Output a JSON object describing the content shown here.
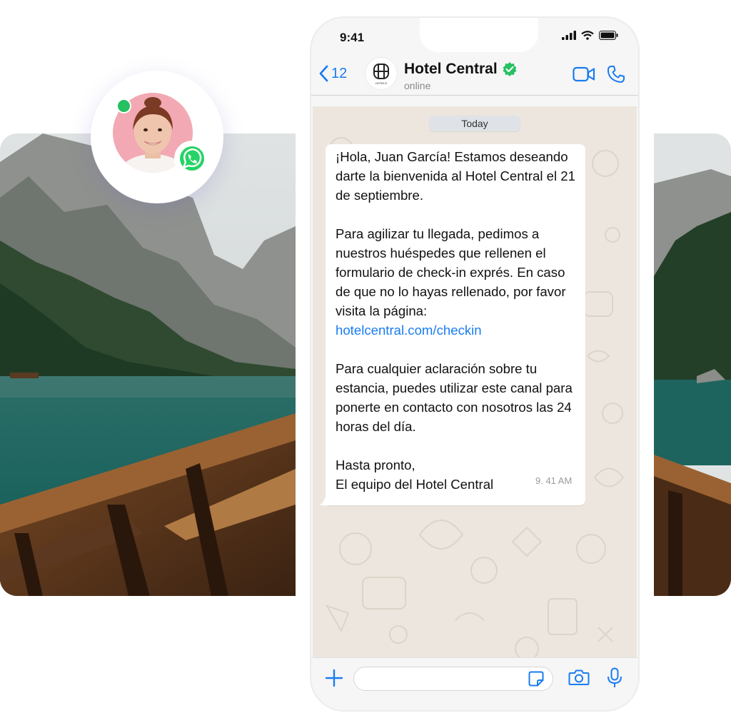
{
  "status_bar": {
    "time": "9:41"
  },
  "header": {
    "back_count": "12",
    "contact_name": "Hotel Central",
    "contact_status": "online",
    "logo_caption": "HOTELS"
  },
  "chat": {
    "date_label": "Today",
    "message": {
      "paragraph_1": "¡Hola, Juan García! Estamos deseando darte la bienvenida al Hotel Central el 21 de septiembre.",
      "paragraph_2": "Para agilizar tu llegada, pedimos a nuestros huéspedes que rellenen el formulario de check-in exprés. En caso de que no lo hayas rellenado, por favor visita la página:",
      "link": "hotelcentral.com/checkin",
      "paragraph_3": "Para cualquier aclaración sobre tu estancia, puedes utilizar este canal para ponerte en contacto con nosotros las 24 horas del día.",
      "signoff_1": "Hasta pronto,",
      "signoff_2": "El equipo del Hotel Central",
      "time": "9. 41 AM"
    }
  },
  "input": {
    "placeholder": ""
  },
  "colors": {
    "accent": "#1a7cf1",
    "verified": "#25c161",
    "chat_background": "#ece6de",
    "whatsapp_green": "#25d366"
  },
  "icons": [
    "chevron-left-icon",
    "verified-check-icon",
    "video-camera-icon",
    "phone-icon",
    "plus-icon",
    "sticker-icon",
    "camera-icon",
    "microphone-icon",
    "whatsapp-icon",
    "signal-icon",
    "wifi-icon",
    "battery-icon"
  ]
}
